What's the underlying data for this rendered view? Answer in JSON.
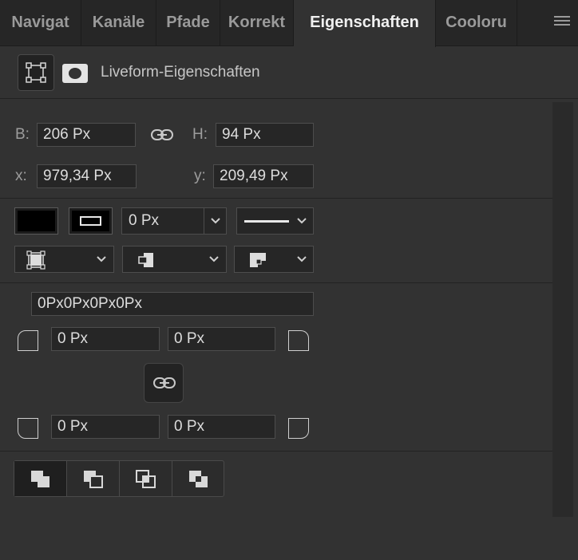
{
  "tabs": [
    {
      "label": "Navigat",
      "active": false
    },
    {
      "label": "Kanäle",
      "active": false
    },
    {
      "label": "Pfade",
      "active": false
    },
    {
      "label": "Korrekt",
      "active": false
    },
    {
      "label": "Eigenschaften",
      "active": true
    },
    {
      "label": "Cooloru",
      "active": false
    }
  ],
  "header": {
    "title": "Liveform-Eigenschaften",
    "shape_icon": "bounding-box-icon",
    "mask_icon": "mask-icon"
  },
  "transform": {
    "width_label": "B:",
    "width_value": "206 Px",
    "height_label": "H:",
    "height_value": "94 Px",
    "x_label": "x:",
    "x_value": "979,34 Px",
    "y_label": "y:",
    "y_value": "209,49 Px"
  },
  "appearance": {
    "fill_color": "#000000",
    "stroke_width_value": "0 Px"
  },
  "corners": {
    "combined_value": "0Px0Px0Px0Px",
    "top_left": "0 Px",
    "top_right": "0 Px",
    "bottom_left": "0 Px",
    "bottom_right": "0 Px"
  },
  "colors": {
    "panel": "#323232",
    "tabbar": "#262626",
    "field": "#262626",
    "text": "#dcdcdc"
  }
}
